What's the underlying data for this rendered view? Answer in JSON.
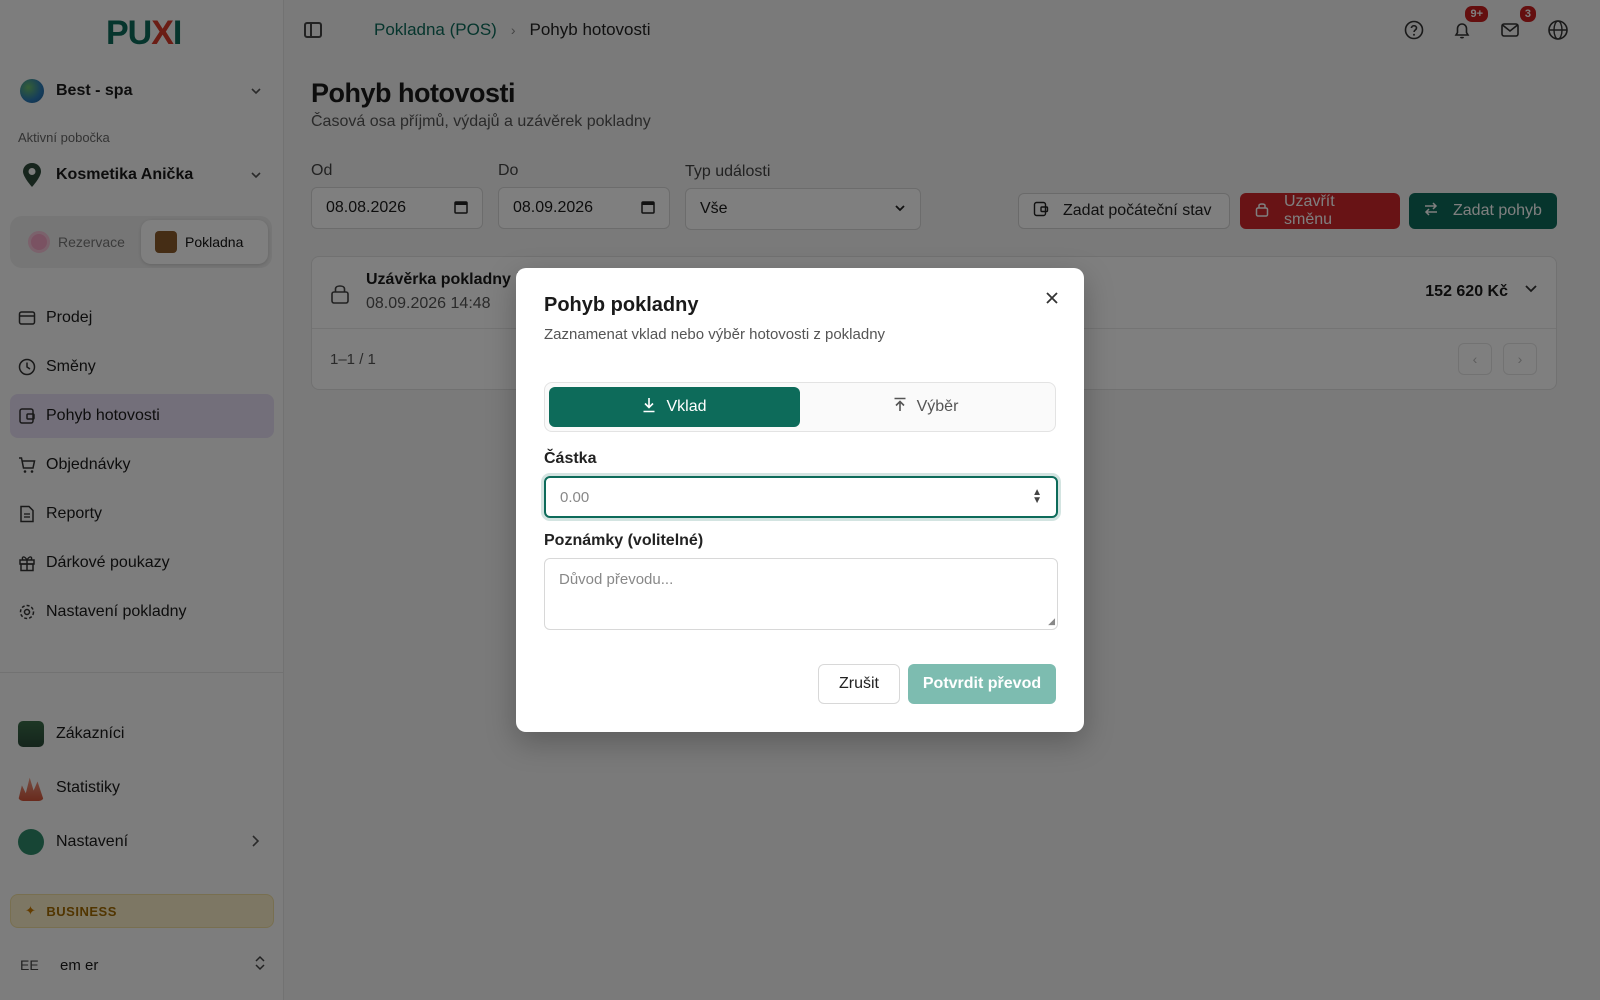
{
  "brand": {
    "logo_left": "PU",
    "logo_x": "X",
    "logo_right": "I"
  },
  "sidebar": {
    "org_name": "Best - spa",
    "branch_label": "Aktivní pobočka",
    "branch_name": "Kosmetika Anička",
    "modules": [
      {
        "label": "Rezervace",
        "active": false
      },
      {
        "label": "Pokladna",
        "active": true
      }
    ],
    "nav": [
      {
        "label": "Prodej",
        "icon": "card-icon"
      },
      {
        "label": "Směny",
        "icon": "clock-icon"
      },
      {
        "label": "Pohyb hotovosti",
        "icon": "wallet-icon",
        "active": true
      },
      {
        "label": "Objednávky",
        "icon": "cart-icon"
      },
      {
        "label": "Reporty",
        "icon": "report-icon"
      },
      {
        "label": "Dárkové poukazy",
        "icon": "gift-icon"
      },
      {
        "label": "Nastavení pokladny",
        "icon": "gear-icon"
      }
    ],
    "nav2": [
      {
        "label": "Zákazníci"
      },
      {
        "label": "Statistiky"
      },
      {
        "label": "Nastavení"
      }
    ],
    "plan": "BUSINESS",
    "user_initials": "EE",
    "user_name": "em er"
  },
  "topbar": {
    "breadcrumb_link": "Pokladna (POS)",
    "breadcrumb_current": "Pohyb hotovosti",
    "notif_badge": "9+",
    "mail_badge": "3"
  },
  "page": {
    "title": "Pohyb hotovosti",
    "subtitle": "Časová osa příjmů, výdajů a uzávěrek pokladny"
  },
  "filters": {
    "from_label": "Od",
    "from_value": "08.08.2026",
    "to_label": "Do",
    "to_value": "08.09.2026",
    "type_label": "Typ události",
    "type_value": "Vše"
  },
  "actions": {
    "initial_state": "Zadat počáteční stav",
    "close_shift": "Uzavřít směnu",
    "add_movement": "Zadat pohyb"
  },
  "timeline": {
    "row_title": "Uzávěrka pokladny č",
    "row_date": "08.09.2026 14:48",
    "row_amount": "152 620 Kč",
    "pagination": "1–1 / 1"
  },
  "modal": {
    "title": "Pohyb pokladny",
    "subtitle": "Zaznamenat vklad nebo výběr hotovosti z pokladny",
    "deposit": "Vklad",
    "withdraw": "Výběr",
    "amount_label": "Částka",
    "amount_placeholder": "0.00",
    "notes_label": "Poznámky (volitelné)",
    "notes_placeholder": "Důvod převodu...",
    "cancel": "Zrušit",
    "confirm": "Potvrdit převod"
  },
  "colors": {
    "accent": "#0d6b5a",
    "danger": "#d1262b",
    "confirm_disabled": "#7dbcb0",
    "active_nav": "#e7dff5"
  }
}
